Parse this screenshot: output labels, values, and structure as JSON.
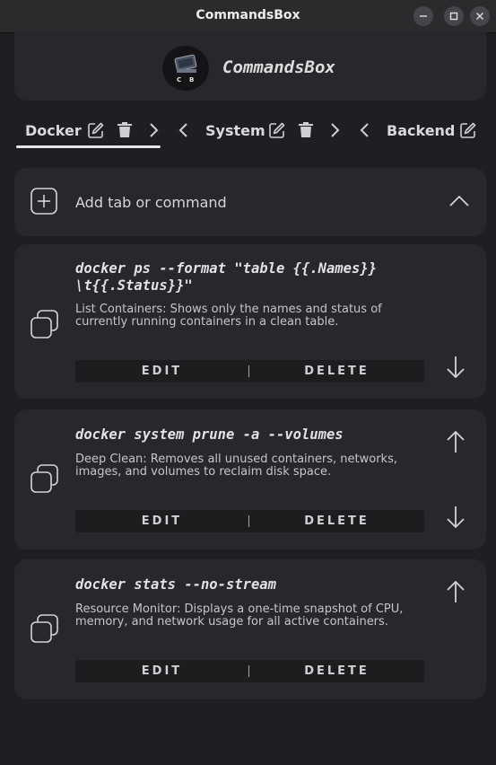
{
  "window": {
    "title": "CommandsBox"
  },
  "header": {
    "app_name": "CommandsBox",
    "logo_text": "C B"
  },
  "tabs": [
    {
      "label": "Docker",
      "active": true
    },
    {
      "label": "System",
      "active": false
    },
    {
      "label": "Backend",
      "active": false
    }
  ],
  "add_card": {
    "label": "Add tab or command"
  },
  "commands": [
    {
      "command": "docker ps --format \"table {{.Names}}\n\\t{{.Status}}\"",
      "description": "List Containers: Shows only the names and status of currently running containers in a clean table.",
      "edit_label": "EDIT",
      "delete_label": "DELETE"
    },
    {
      "command": "docker system prune -a --volumes",
      "description": "Deep Clean: Removes all unused containers, networks, images, and volumes to reclaim disk space.",
      "edit_label": "EDIT",
      "delete_label": "DELETE"
    },
    {
      "command": "docker stats --no-stream",
      "description": "Resource Monitor: Displays a one-time snapshot of CPU, memory, and network usage for all active containers.",
      "edit_label": "EDIT",
      "delete_label": "DELETE"
    }
  ],
  "colors": {
    "background": "#1f1f23",
    "card": "#28282c",
    "titlebar": "#2b2b2e",
    "text": "#d8d8dc"
  }
}
